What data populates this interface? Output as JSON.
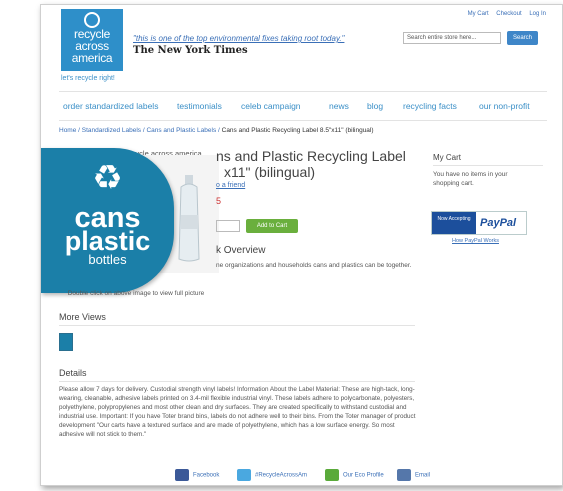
{
  "header": {
    "logo_lines": [
      "recycle",
      "across",
      "america"
    ],
    "tagline": "let's recycle right!",
    "nyt_quote": "\"this is one of the top environmental fixes taking root today.\"",
    "nyt_name": "The New York Times",
    "top_links": [
      "My Cart",
      "Checkout",
      "Log In"
    ],
    "search_placeholder": "Search entire store here...",
    "search_button": "Search"
  },
  "nav": {
    "items": [
      "order standardized labels",
      "testimonials",
      "celeb campaign",
      "news",
      "blog",
      "recycling facts",
      "our non-profit"
    ]
  },
  "breadcrumb": {
    "items": [
      "Home",
      "Standardized Labels",
      "Cans and Plastic Labels"
    ],
    "current": "Cans and Plastic Recycling Label 8.5\"x11\" (bilingual)"
  },
  "product": {
    "title_line1": "ns and Plastic Recycling Label",
    "title_line2": "x11\" (bilingual)",
    "email_friend": "o a friend",
    "price": "5",
    "add_to_cart": "Add to Cart",
    "overview_heading": "k Overview",
    "overview_text": "ne organizations and households cans and plastics can be together.",
    "brand_small": "recycle across america",
    "zoom_text": "Double click on above image to view full picture"
  },
  "label": {
    "symbol": "♻",
    "line1": "cans",
    "line2": "plastic",
    "line3": "bottles"
  },
  "more_views": {
    "heading": "More Views"
  },
  "details": {
    "heading": "Details",
    "text": "Please allow 7 days for delivery. Custodial strength vinyl labels! Information About the Label Material: These are high-tack, long-wearing, cleanable, adhesive labels printed on 3.4-mil flexible industrial vinyl. These labels adhere to polycarbonate, polyesters, polyethylene, polypropylenes and most other clean and dry surfaces. They are created specifically to withstand custodial and industrial use. Important: If you have Toter brand bins, labels do not adhere well to their bins. From the Toter manager of product development \"Our carts have a textured surface and are made of polyethylene, which has a low surface energy. So most adhesive will not stick to them.\""
  },
  "sidebar": {
    "cart_heading": "My Cart",
    "cart_text": "You have no items in your shopping cart.",
    "paypal_now": "Now Accepting",
    "paypal_brand": "PayPal",
    "paypal_link": "How PayPal Works"
  },
  "footer": {
    "items": [
      {
        "label": "Facebook",
        "color": "#3b5998"
      },
      {
        "label": "#RecycleAcrossAm",
        "color": "#4aa8e0"
      },
      {
        "label": "Our Eco Profile",
        "color": "#5aaa3a"
      },
      {
        "label": "Email",
        "color": "#5577aa"
      }
    ]
  },
  "colors": {
    "brand_blue": "#2e8fc9",
    "label_teal": "#1b7fa8",
    "cart_green": "#6aaf3d"
  }
}
